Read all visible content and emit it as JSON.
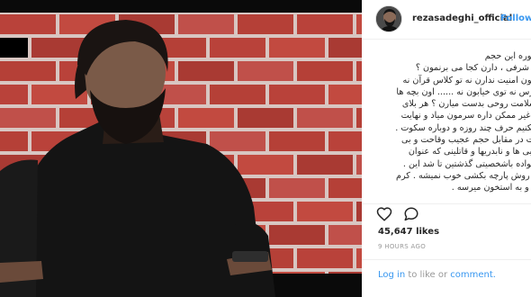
{
  "post": {
    "username": "rezasadeghi_official",
    "follow_label": "Follow",
    "caption_lines": [
      "از تصوره این حجم",
      "از بی شرفی ، دارن کجا می برنمون ؟",
      "ه هامون امنیت ندارن نه تو کلاس قرآن نه",
      "س درس نه توی خیابون نه ...... اون بچه ها",
      "یگه سلامت روحی بدست میارن ؟ هر بلای",
      "کن و غیر ممکن داره سرمون میاد و نهایت",
      "که میکنیم حرف چند روزه و دوباره سکوت .",
      "سکوت در مقابل حجم عجیب وقاحت و بی",
      "از مربی ها و نابدریها و قاتلینی که عنوان",
      "از خانواده باشخصیتی گذشتین تا شد این .",
      "ی که روش پارچه بکشی خوب نمیشه . کرم",
      "میزنه و به استخون میرسه ."
    ],
    "likes": "45,647 likes",
    "timestamp": "9 HOURS AGO",
    "login": {
      "login_label": "Log in",
      "middle_text": " to like or ",
      "comment_label": "comment."
    }
  },
  "icons": {
    "like": "heart-icon",
    "comment": "comment-icon"
  },
  "colors": {
    "accent": "#3897f0",
    "text": "#262626",
    "muted": "#999999",
    "brick": "#b9423a",
    "mortar": "#d9c7c4"
  }
}
